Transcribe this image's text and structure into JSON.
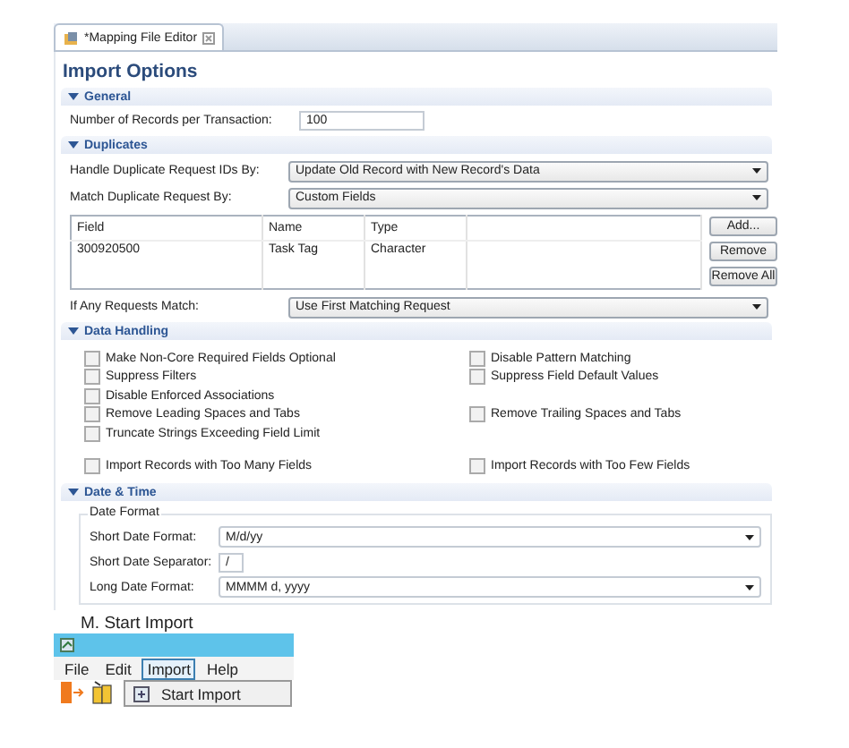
{
  "editor_tab": {
    "title": "*Mapping File Editor"
  },
  "heading": "Import Options",
  "general": {
    "title": "General",
    "expanded": true,
    "records": {
      "label": "Number of Records per Transaction:",
      "value": "100"
    }
  },
  "duplicates": {
    "title": "Duplicates",
    "expanded": true,
    "handle": {
      "label": "Handle Duplicate Request IDs By:",
      "value": "Update Old Record with New Record's Data"
    },
    "match": {
      "label": "Match Duplicate Request By:",
      "value": "Custom Fields"
    },
    "table": {
      "columns": [
        "Field",
        "Name",
        "Type"
      ],
      "rows": [
        [
          "300920500",
          "Task Tag",
          "Character"
        ]
      ]
    },
    "buttons": [
      "Add...",
      "Remove",
      "Remove All"
    ],
    "if_any": {
      "label": "If Any Requests Match:",
      "value": "Use First Matching Request"
    }
  },
  "data_handling": {
    "title": "Data Handling",
    "expanded": true,
    "rows": [
      {
        "left": {
          "label": "Make Non-Core Required Fields Optional",
          "checked": false
        },
        "right": {
          "label": "Disable Pattern Matching",
          "checked": false
        }
      },
      {
        "left": {
          "label": "Suppress Filters",
          "checked": false
        },
        "right": {
          "label": "Suppress Field Default Values",
          "checked": false
        }
      },
      {
        "left": {
          "label": "Disable Enforced Associations",
          "checked": false
        }
      },
      {
        "left": {
          "label": "Remove Leading Spaces and Tabs",
          "checked": false
        },
        "right": {
          "label": "Remove Trailing Spaces and Tabs",
          "checked": false
        }
      },
      {
        "left": {
          "label": "Truncate Strings Exceeding Field Limit",
          "checked": false
        }
      },
      {
        "left": {
          "label": "Import Records with Too Many Fields",
          "checked": false
        },
        "right": {
          "label": "Import Records with Too Few Fields",
          "checked": false
        }
      }
    ]
  },
  "date_time": {
    "title": "Date & Time",
    "expanded": true,
    "group": "Date Format",
    "fields": [
      {
        "kind": "combo",
        "label": "Short Date Format:",
        "value": "M/d/yy"
      },
      {
        "kind": "text",
        "label": "Short Date Separator:",
        "value": "/"
      },
      {
        "kind": "combo",
        "label": "Long Date Format:",
        "value": "MMMM d, yyyy"
      }
    ]
  },
  "caption": "M.  Start Import",
  "app": {
    "menus": [
      {
        "label": "File",
        "selected": false
      },
      {
        "label": "Edit",
        "selected": false
      },
      {
        "label": "Import",
        "selected": true
      },
      {
        "label": "Help",
        "selected": false
      }
    ],
    "menu_items": [
      {
        "label": "Start Import"
      }
    ]
  }
}
